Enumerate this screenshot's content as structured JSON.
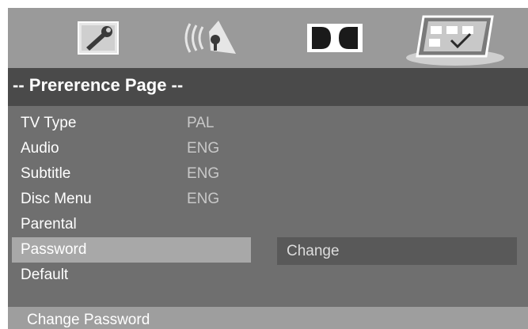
{
  "tabs": [
    {
      "icon": "general-setup-icon"
    },
    {
      "icon": "audio-setup-icon"
    },
    {
      "icon": "dolby-digital-icon"
    },
    {
      "icon": "preference-checkbox-icon",
      "selected": true
    }
  ],
  "title": "-- Prererence Page --",
  "menu": {
    "items": [
      {
        "label": "TV Type",
        "value": "PAL"
      },
      {
        "label": "Audio",
        "value": "ENG"
      },
      {
        "label": "Subtitle",
        "value": "ENG"
      },
      {
        "label": "Disc Menu",
        "value": "ENG"
      },
      {
        "label": "Parental",
        "value": ""
      },
      {
        "label": "Password",
        "value": "",
        "selected": true
      },
      {
        "label": "Default",
        "value": ""
      }
    ]
  },
  "submenu": {
    "option": "Change"
  },
  "status": "Change Password",
  "colors": {
    "screen_bg": "#6f6f6f",
    "tabbar_bg": "#9a9a9a",
    "titlebar_bg": "#4a4a4a",
    "selected_row": "#a8a8a8",
    "option_bg": "#595959",
    "statusbar_bg": "#9e9e9e",
    "value_text": "#c8c8c8"
  }
}
